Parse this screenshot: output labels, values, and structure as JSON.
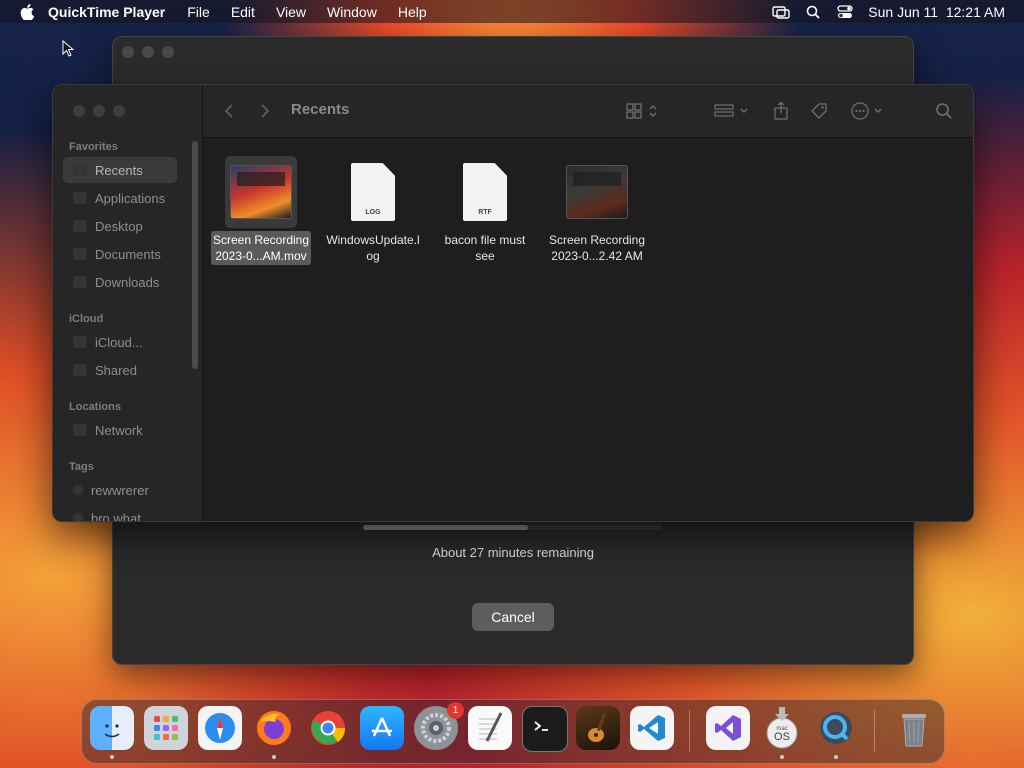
{
  "menubar": {
    "app_name": "QuickTime Player",
    "menus": [
      "File",
      "Edit",
      "View",
      "Window",
      "Help"
    ],
    "datetime": "Sun Jun 11  12:21 AM"
  },
  "quicktime": {
    "status_text": "About 27 minutes remaining",
    "cancel_label": "Cancel"
  },
  "finder": {
    "location_title": "Recents",
    "sidebar": {
      "favorites_header": "Favorites",
      "favorites": [
        "Recents",
        "Applications",
        "Desktop",
        "Documents",
        "Downloads"
      ],
      "icloud_header": "iCloud",
      "icloud": [
        "iCloud...",
        "Shared"
      ],
      "locations_header": "Locations",
      "locations": [
        "Network"
      ],
      "tags_header": "Tags",
      "tags": [
        "rewwrerer",
        "bro what"
      ]
    },
    "files": [
      {
        "name_line1": "Screen Recording",
        "name_line2": "2023-0...AM.mov",
        "kind": "video"
      },
      {
        "name_line1": "WindowsUpdate.l",
        "name_line2": "og",
        "kind": "doc",
        "tag": "LOG"
      },
      {
        "name_line1": "bacon file must",
        "name_line2": "see",
        "kind": "doc",
        "tag": "RTF"
      },
      {
        "name_line1": "Screen Recording",
        "name_line2": "2023-0...2.42 AM",
        "kind": "video"
      }
    ]
  },
  "dock": {
    "settings_badge": "1",
    "apps": [
      "finder-icon",
      "launchpad-icon",
      "safari-icon",
      "firefox-icon",
      "chrome-icon",
      "app-store-icon",
      "system-settings-icon",
      "textedit-icon",
      "terminal-icon",
      "garageband-icon",
      "vscode-icon",
      "visual-studio-icon",
      "macos-installer-icon",
      "quicktime-icon",
      "trash-icon"
    ]
  },
  "colors": {
    "highlight": "#5a5a5a",
    "accent_red": "#e5342e"
  }
}
